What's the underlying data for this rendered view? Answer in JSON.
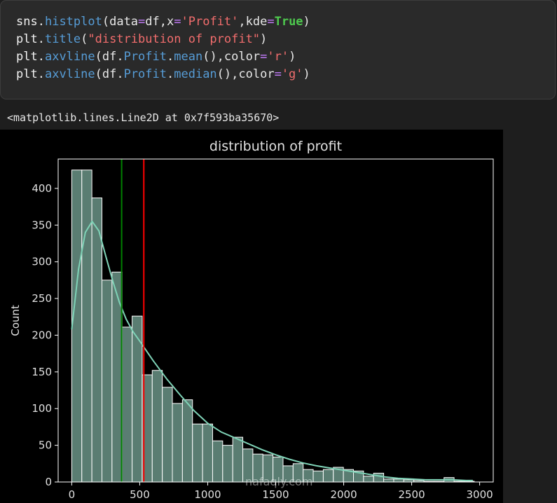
{
  "code": {
    "lines": [
      [
        {
          "t": "sns",
          "c": "name"
        },
        {
          "t": ".",
          "c": "punc"
        },
        {
          "t": "histplot",
          "c": "func"
        },
        {
          "t": "(data",
          "c": "punc"
        },
        {
          "t": "=",
          "c": "op"
        },
        {
          "t": "df,x",
          "c": "punc"
        },
        {
          "t": "=",
          "c": "op"
        },
        {
          "t": "'Profit'",
          "c": "str"
        },
        {
          "t": ",kde",
          "c": "punc"
        },
        {
          "t": "=",
          "c": "op"
        },
        {
          "t": "True",
          "c": "kw"
        },
        {
          "t": ")",
          "c": "punc"
        }
      ],
      [
        {
          "t": "plt",
          "c": "name"
        },
        {
          "t": ".",
          "c": "punc"
        },
        {
          "t": "title",
          "c": "func"
        },
        {
          "t": "(",
          "c": "punc"
        },
        {
          "t": "\"distribution of profit\"",
          "c": "str"
        },
        {
          "t": ")",
          "c": "punc"
        }
      ],
      [
        {
          "t": "plt",
          "c": "name"
        },
        {
          "t": ".",
          "c": "punc"
        },
        {
          "t": "axvline",
          "c": "func"
        },
        {
          "t": "(df.",
          "c": "punc"
        },
        {
          "t": "Profit",
          "c": "func"
        },
        {
          "t": ".",
          "c": "punc"
        },
        {
          "t": "mean",
          "c": "func"
        },
        {
          "t": "(),color",
          "c": "punc"
        },
        {
          "t": "=",
          "c": "op"
        },
        {
          "t": "'r'",
          "c": "str"
        },
        {
          "t": ")",
          "c": "punc"
        }
      ],
      [
        {
          "t": "plt",
          "c": "name"
        },
        {
          "t": ".",
          "c": "punc"
        },
        {
          "t": "axvline",
          "c": "func"
        },
        {
          "t": "(df.",
          "c": "punc"
        },
        {
          "t": "Profit",
          "c": "func"
        },
        {
          "t": ".",
          "c": "punc"
        },
        {
          "t": "median",
          "c": "func"
        },
        {
          "t": "(),color",
          "c": "punc"
        },
        {
          "t": "=",
          "c": "op"
        },
        {
          "t": "'g'",
          "c": "str"
        },
        {
          "t": ")",
          "c": "punc"
        }
      ]
    ]
  },
  "output": {
    "text": "<matplotlib.lines.Line2D at 0x7f593ba35670>"
  },
  "watermark": "nafaqly.com",
  "chart_data": {
    "type": "bar",
    "title": "distribution of profit",
    "xlabel": "",
    "ylabel": "Count",
    "xlim": [
      -100,
      3100
    ],
    "ylim": [
      0,
      440
    ],
    "xticks": [
      0,
      500,
      1000,
      1500,
      2000,
      2500,
      3000
    ],
    "yticks": [
      0,
      50,
      100,
      150,
      200,
      250,
      300,
      350,
      400
    ],
    "bin_width": 74,
    "bins": [
      {
        "x0": 0,
        "count": 425
      },
      {
        "x0": 74,
        "count": 425
      },
      {
        "x0": 148,
        "count": 387
      },
      {
        "x0": 222,
        "count": 275
      },
      {
        "x0": 296,
        "count": 286
      },
      {
        "x0": 370,
        "count": 211
      },
      {
        "x0": 444,
        "count": 226
      },
      {
        "x0": 518,
        "count": 146
      },
      {
        "x0": 592,
        "count": 152
      },
      {
        "x0": 666,
        "count": 129
      },
      {
        "x0": 740,
        "count": 107
      },
      {
        "x0": 814,
        "count": 112
      },
      {
        "x0": 888,
        "count": 79
      },
      {
        "x0": 962,
        "count": 79
      },
      {
        "x0": 1036,
        "count": 56
      },
      {
        "x0": 1110,
        "count": 50
      },
      {
        "x0": 1184,
        "count": 61
      },
      {
        "x0": 1258,
        "count": 45
      },
      {
        "x0": 1332,
        "count": 38
      },
      {
        "x0": 1406,
        "count": 37
      },
      {
        "x0": 1480,
        "count": 34
      },
      {
        "x0": 1554,
        "count": 22
      },
      {
        "x0": 1628,
        "count": 25
      },
      {
        "x0": 1702,
        "count": 17
      },
      {
        "x0": 1776,
        "count": 15
      },
      {
        "x0": 1850,
        "count": 17
      },
      {
        "x0": 1924,
        "count": 20
      },
      {
        "x0": 1998,
        "count": 17
      },
      {
        "x0": 2072,
        "count": 15
      },
      {
        "x0": 2146,
        "count": 8
      },
      {
        "x0": 2220,
        "count": 12
      },
      {
        "x0": 2294,
        "count": 4
      },
      {
        "x0": 2368,
        "count": 4
      },
      {
        "x0": 2442,
        "count": 3
      },
      {
        "x0": 2516,
        "count": 2
      },
      {
        "x0": 2590,
        "count": 1
      },
      {
        "x0": 2664,
        "count": 1
      },
      {
        "x0": 2738,
        "count": 6
      },
      {
        "x0": 2812,
        "count": 1
      },
      {
        "x0": 2886,
        "count": 1
      }
    ],
    "kde": [
      {
        "x": 0,
        "y": 208
      },
      {
        "x": 50,
        "y": 290
      },
      {
        "x": 100,
        "y": 340
      },
      {
        "x": 150,
        "y": 355
      },
      {
        "x": 200,
        "y": 342
      },
      {
        "x": 250,
        "y": 308
      },
      {
        "x": 300,
        "y": 275
      },
      {
        "x": 350,
        "y": 245
      },
      {
        "x": 400,
        "y": 222
      },
      {
        "x": 450,
        "y": 205
      },
      {
        "x": 500,
        "y": 192
      },
      {
        "x": 600,
        "y": 165
      },
      {
        "x": 700,
        "y": 140
      },
      {
        "x": 800,
        "y": 118
      },
      {
        "x": 900,
        "y": 97
      },
      {
        "x": 1000,
        "y": 80
      },
      {
        "x": 1100,
        "y": 68
      },
      {
        "x": 1200,
        "y": 60
      },
      {
        "x": 1300,
        "y": 52
      },
      {
        "x": 1400,
        "y": 44
      },
      {
        "x": 1500,
        "y": 37
      },
      {
        "x": 1600,
        "y": 31
      },
      {
        "x": 1700,
        "y": 26
      },
      {
        "x": 1800,
        "y": 22
      },
      {
        "x": 1900,
        "y": 19
      },
      {
        "x": 2000,
        "y": 16
      },
      {
        "x": 2100,
        "y": 13
      },
      {
        "x": 2200,
        "y": 10
      },
      {
        "x": 2300,
        "y": 7
      },
      {
        "x": 2400,
        "y": 5
      },
      {
        "x": 2500,
        "y": 4
      },
      {
        "x": 2600,
        "y": 3
      },
      {
        "x": 2700,
        "y": 3
      },
      {
        "x": 2800,
        "y": 3
      },
      {
        "x": 2900,
        "y": 2
      },
      {
        "x": 2950,
        "y": 2
      }
    ],
    "vlines": [
      {
        "label": "median",
        "x": 367,
        "color": "#008000"
      },
      {
        "label": "mean",
        "x": 530,
        "color": "#ff0000"
      }
    ],
    "colors": {
      "bar_fill": "#5a7d72",
      "bar_edge": "#ffffff",
      "kde_line": "#7fd3b7",
      "axes": "#ffffff",
      "text": "#e0e0e0",
      "background": "#000000"
    }
  }
}
